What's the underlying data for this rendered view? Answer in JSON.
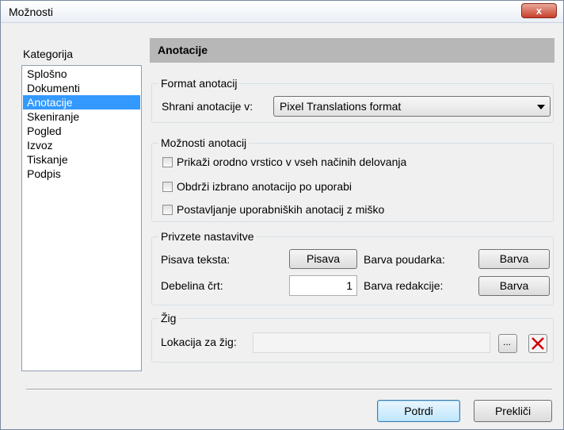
{
  "window": {
    "title": "Možnosti",
    "close_glyph": "x"
  },
  "sidebar": {
    "label": "Kategorija",
    "items": [
      {
        "label": "Splošno"
      },
      {
        "label": "Dokumenti"
      },
      {
        "label": "Anotacije",
        "selected": true
      },
      {
        "label": "Skeniranje"
      },
      {
        "label": "Pogled"
      },
      {
        "label": "Izvoz"
      },
      {
        "label": "Tiskanje"
      },
      {
        "label": "Podpis"
      }
    ]
  },
  "panel": {
    "title": "Anotacije",
    "format_group": {
      "title": "Format anotacij",
      "save_label": "Shrani anotacije v:",
      "save_value": "Pixel Translations format"
    },
    "options_group": {
      "title": "Možnosti anotacij",
      "checkboxes": [
        {
          "label": "Prikaži orodno vrstico v vseh načinih delovanja",
          "checked": false
        },
        {
          "label": "Obdrži izbrano anotacijo po uporabi",
          "checked": false
        },
        {
          "label": "Postavljanje uporabniških anotacij z miško",
          "checked": false
        }
      ]
    },
    "defaults_group": {
      "title": "Privzete nastavitve",
      "font_label": "Pisava teksta:",
      "font_button": "Pisava",
      "highlight_label": "Barva poudarka:",
      "highlight_button": "Barva",
      "line_width_label": "Debelina črt:",
      "line_width_value": "1",
      "redaction_label": "Barva redakcije:",
      "redaction_button": "Barva"
    },
    "stamp_group": {
      "title": "Žig",
      "location_label": "Lokacija za žig:",
      "location_value": "",
      "browse_label": "..."
    }
  },
  "footer": {
    "ok_label": "Potrdi",
    "cancel_label": "Prekliči"
  },
  "colors": {
    "selection": "#3399ff",
    "header_band": "#b7b7b7",
    "close_button": "#c8402c",
    "clear_icon": "#d40000"
  }
}
